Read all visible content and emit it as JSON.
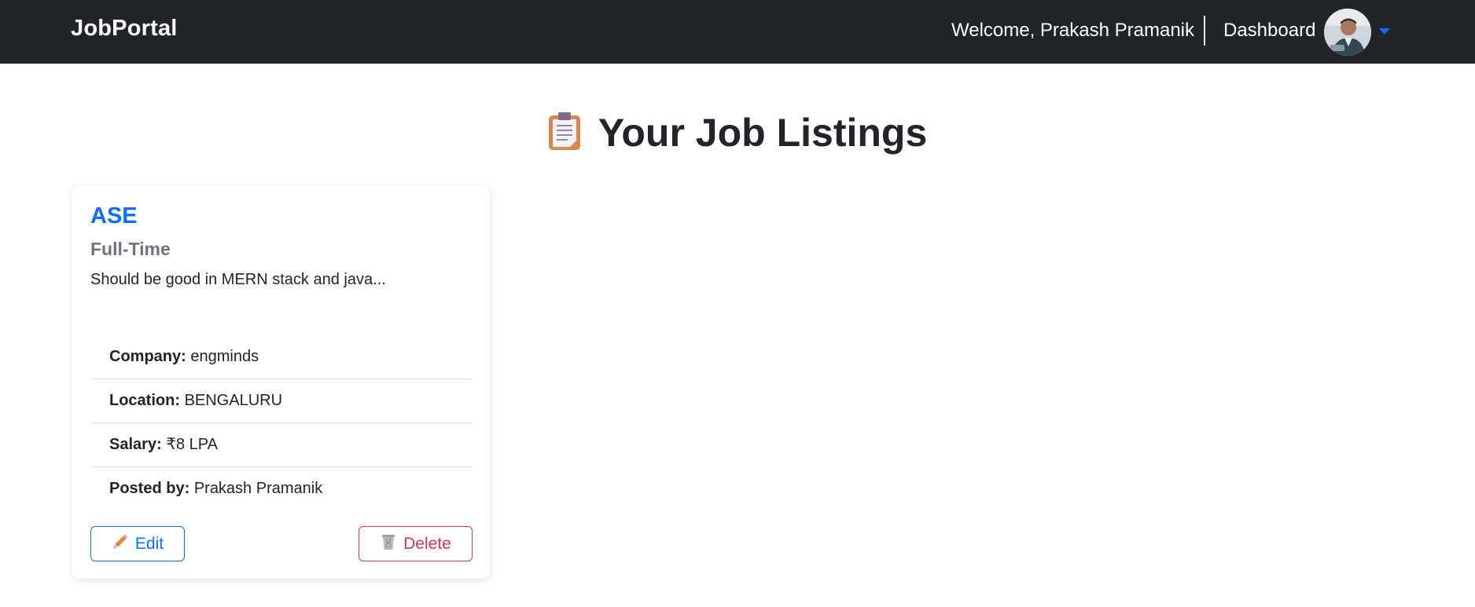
{
  "navbar": {
    "brand": "JobPortal",
    "welcome": "Welcome, Prakash Pramanik",
    "dashboard_label": "Dashboard"
  },
  "page": {
    "title": "Your Job Listings",
    "title_icon": "clipboard-icon"
  },
  "jobs": [
    {
      "title": "ASE",
      "type": "Full-Time",
      "description": "Should be good in MERN stack and java...",
      "company_label": "Company:",
      "company": "engminds",
      "location_label": "Location:",
      "location": "BENGALURU",
      "salary_label": "Salary:",
      "salary": "₹8 LPA",
      "posted_by_label": "Posted by:",
      "posted_by": "Prakash Pramanik",
      "edit_label": "Edit",
      "edit_icon": "pencil-icon",
      "delete_label": "Delete",
      "delete_icon": "wastebasket-icon"
    }
  ],
  "colors": {
    "navbar_bg": "#212529",
    "primary": "#0d6efd",
    "danger": "#dc3545",
    "muted": "#6c757d"
  }
}
